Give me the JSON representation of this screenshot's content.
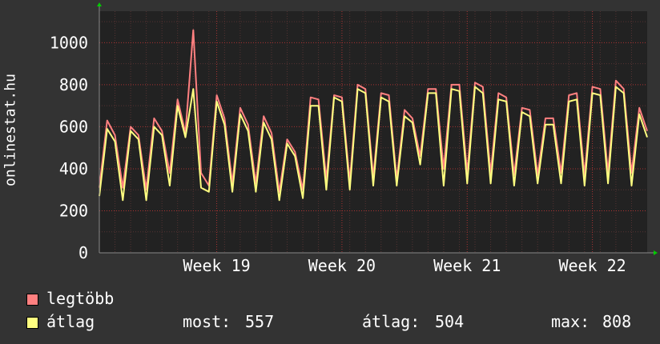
{
  "chart_data": {
    "type": "line",
    "ylabel": "onlinestat.hu",
    "ylim": [
      0,
      1150
    ],
    "yticks": [
      0,
      200,
      400,
      600,
      800,
      1000
    ],
    "x_ticks": [
      "Week 19",
      "Week 20",
      "Week 21",
      "Week 22"
    ],
    "x_domain_days": [
      0,
      35
    ],
    "x_tick_positions_days": [
      7.5,
      15.5,
      23.5,
      31.5
    ],
    "background": "#222222",
    "grid": true,
    "grid_color": "#aa3333",
    "series": [
      {
        "name": "legtöbb",
        "color": "#ff8080",
        "values": [
          310,
          630,
          560,
          310,
          600,
          560,
          300,
          640,
          580,
          380,
          730,
          570,
          1060,
          380,
          320,
          750,
          640,
          330,
          690,
          610,
          330,
          650,
          570,
          290,
          540,
          480,
          300,
          740,
          730,
          350,
          750,
          740,
          340,
          800,
          780,
          360,
          760,
          750,
          350,
          680,
          640,
          460,
          780,
          780,
          400,
          800,
          800,
          380,
          810,
          790,
          380,
          760,
          740,
          370,
          690,
          680,
          370,
          640,
          640,
          380,
          750,
          760,
          370,
          790,
          780,
          380,
          820,
          780,
          380,
          690,
          580
        ]
      },
      {
        "name": "átlag",
        "color": "#ffff80",
        "values": [
          270,
          590,
          530,
          250,
          580,
          540,
          250,
          600,
          560,
          320,
          700,
          550,
          780,
          310,
          290,
          720,
          610,
          290,
          660,
          580,
          290,
          620,
          540,
          250,
          520,
          460,
          260,
          700,
          700,
          300,
          740,
          720,
          300,
          780,
          760,
          320,
          740,
          720,
          320,
          650,
          620,
          420,
          760,
          760,
          320,
          780,
          770,
          330,
          790,
          760,
          330,
          730,
          720,
          320,
          670,
          650,
          330,
          610,
          610,
          330,
          720,
          730,
          320,
          760,
          750,
          330,
          790,
          760,
          320,
          660,
          550
        ]
      }
    ]
  },
  "legend": {
    "items": [
      {
        "label": "legtöbb",
        "color": "#ff8080"
      },
      {
        "label": "átlag",
        "color": "#ffff80"
      }
    ],
    "stats": [
      {
        "label": "most:",
        "value": "557"
      },
      {
        "label": "átlag:",
        "value": "504"
      },
      {
        "label": "max:",
        "value": "808"
      }
    ]
  }
}
